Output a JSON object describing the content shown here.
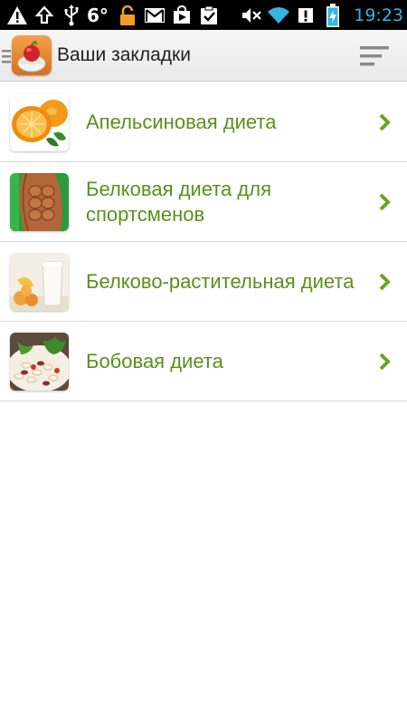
{
  "status_bar": {
    "temperature": "6°",
    "time": "19:23",
    "icons": [
      "warning-icon",
      "upload-icon",
      "usb-icon",
      "lock-icon",
      "gmail-icon",
      "play-store-icon",
      "clipboard-check-icon",
      "mute-icon",
      "wifi-icon",
      "alert-icon",
      "battery-charging-icon"
    ]
  },
  "action_bar": {
    "title": "Ваши закладки",
    "icons": [
      "menu-icon",
      "app-logo-icon",
      "sort-icon"
    ]
  },
  "bookmarks": [
    {
      "label": "Апельсиновая диета",
      "thumb": "orange-thumbnail"
    },
    {
      "label": "Белковая диета для спортсменов",
      "thumb": "athlete-thumbnail"
    },
    {
      "label": "Белково-растительная диета",
      "thumb": "milk-fruit-thumbnail"
    },
    {
      "label": "Бобовая диета",
      "thumb": "bean-salad-thumbnail"
    }
  ],
  "colors": {
    "label_green": "#5a8f1c",
    "chevron_green": "#6aa51f",
    "time_blue": "#33b5e5"
  }
}
